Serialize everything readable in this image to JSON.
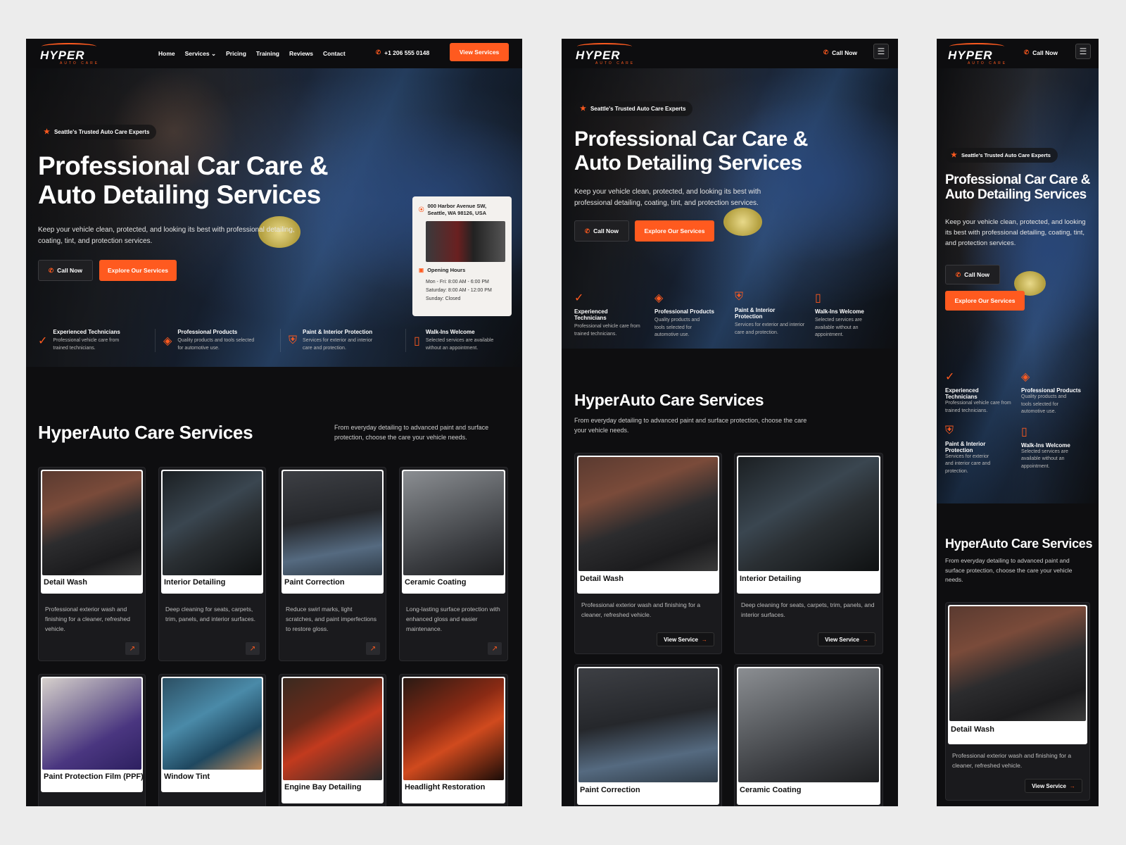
{
  "brand": {
    "logo_text": "HYPER",
    "logo_sub": "AUTO CARE",
    "accent": "#ff5a1f"
  },
  "nav": {
    "links": [
      "Home",
      "Services",
      "Pricing",
      "Training",
      "Reviews",
      "Contact"
    ],
    "phone": "+1 206 555 0148",
    "cta": "View Services",
    "call_now": "Call Now"
  },
  "hero": {
    "badge": "Seattle's Trusted Auto Care Experts",
    "title_line1": "Professional Car Care &",
    "title_line2": "Auto Detailing Services",
    "lead": "Keep your vehicle clean, protected, and looking its best with professional detailing, coating, tint, and protection services.",
    "btn_call": "Call Now",
    "btn_explore": "Explore Our Services"
  },
  "location_card": {
    "address_line1": "000 Harbor Avenue SW,",
    "address_line2": "Seattle, WA 98126, USA",
    "hours_title": "Opening Hours",
    "hours": [
      "Mon - Fri:  8:00 AM - 6:00 PM",
      "Saturday:  8:00 AM - 12:00 PM",
      "Sunday:  Closed"
    ]
  },
  "features": [
    {
      "title": "Experienced Technicians",
      "desc": "Professional vehicle care from trained technicians.",
      "icon": "check-circle-icon"
    },
    {
      "title": "Professional Products",
      "desc": "Quality products and tools selected for automotive use.",
      "icon": "box-icon"
    },
    {
      "title": "Paint & Interior Protection",
      "desc": "Services for exterior and interior care and protection.",
      "icon": "shield-icon"
    },
    {
      "title": "Walk-Ins Welcome",
      "desc": "Selected services are available without an appointment.",
      "icon": "door-icon"
    }
  ],
  "services_section": {
    "title": "HyperAuto Care Services",
    "desc": "From everyday detailing to advanced paint and surface protection, choose the care your vehicle needs.",
    "view_service": "View Service"
  },
  "services": [
    {
      "name": "Detail Wash",
      "desc": "Professional exterior wash and finishing for a cleaner, refreshed vehicle."
    },
    {
      "name": "Interior Detailing",
      "desc": "Deep cleaning for seats, carpets, trim, panels, and interior surfaces."
    },
    {
      "name": "Paint Correction",
      "desc": "Reduce swirl marks, light scratches, and paint imperfections to restore gloss."
    },
    {
      "name": "Ceramic Coating",
      "desc": "Long-lasting surface protection with enhanced gloss and easier maintenance."
    },
    {
      "name": "Paint Protection Film (PPF)",
      "desc": ""
    },
    {
      "name": "Window Tint",
      "desc": ""
    },
    {
      "name": "Engine Bay Detailing",
      "desc": ""
    },
    {
      "name": "Headlight Restoration",
      "desc": ""
    }
  ]
}
